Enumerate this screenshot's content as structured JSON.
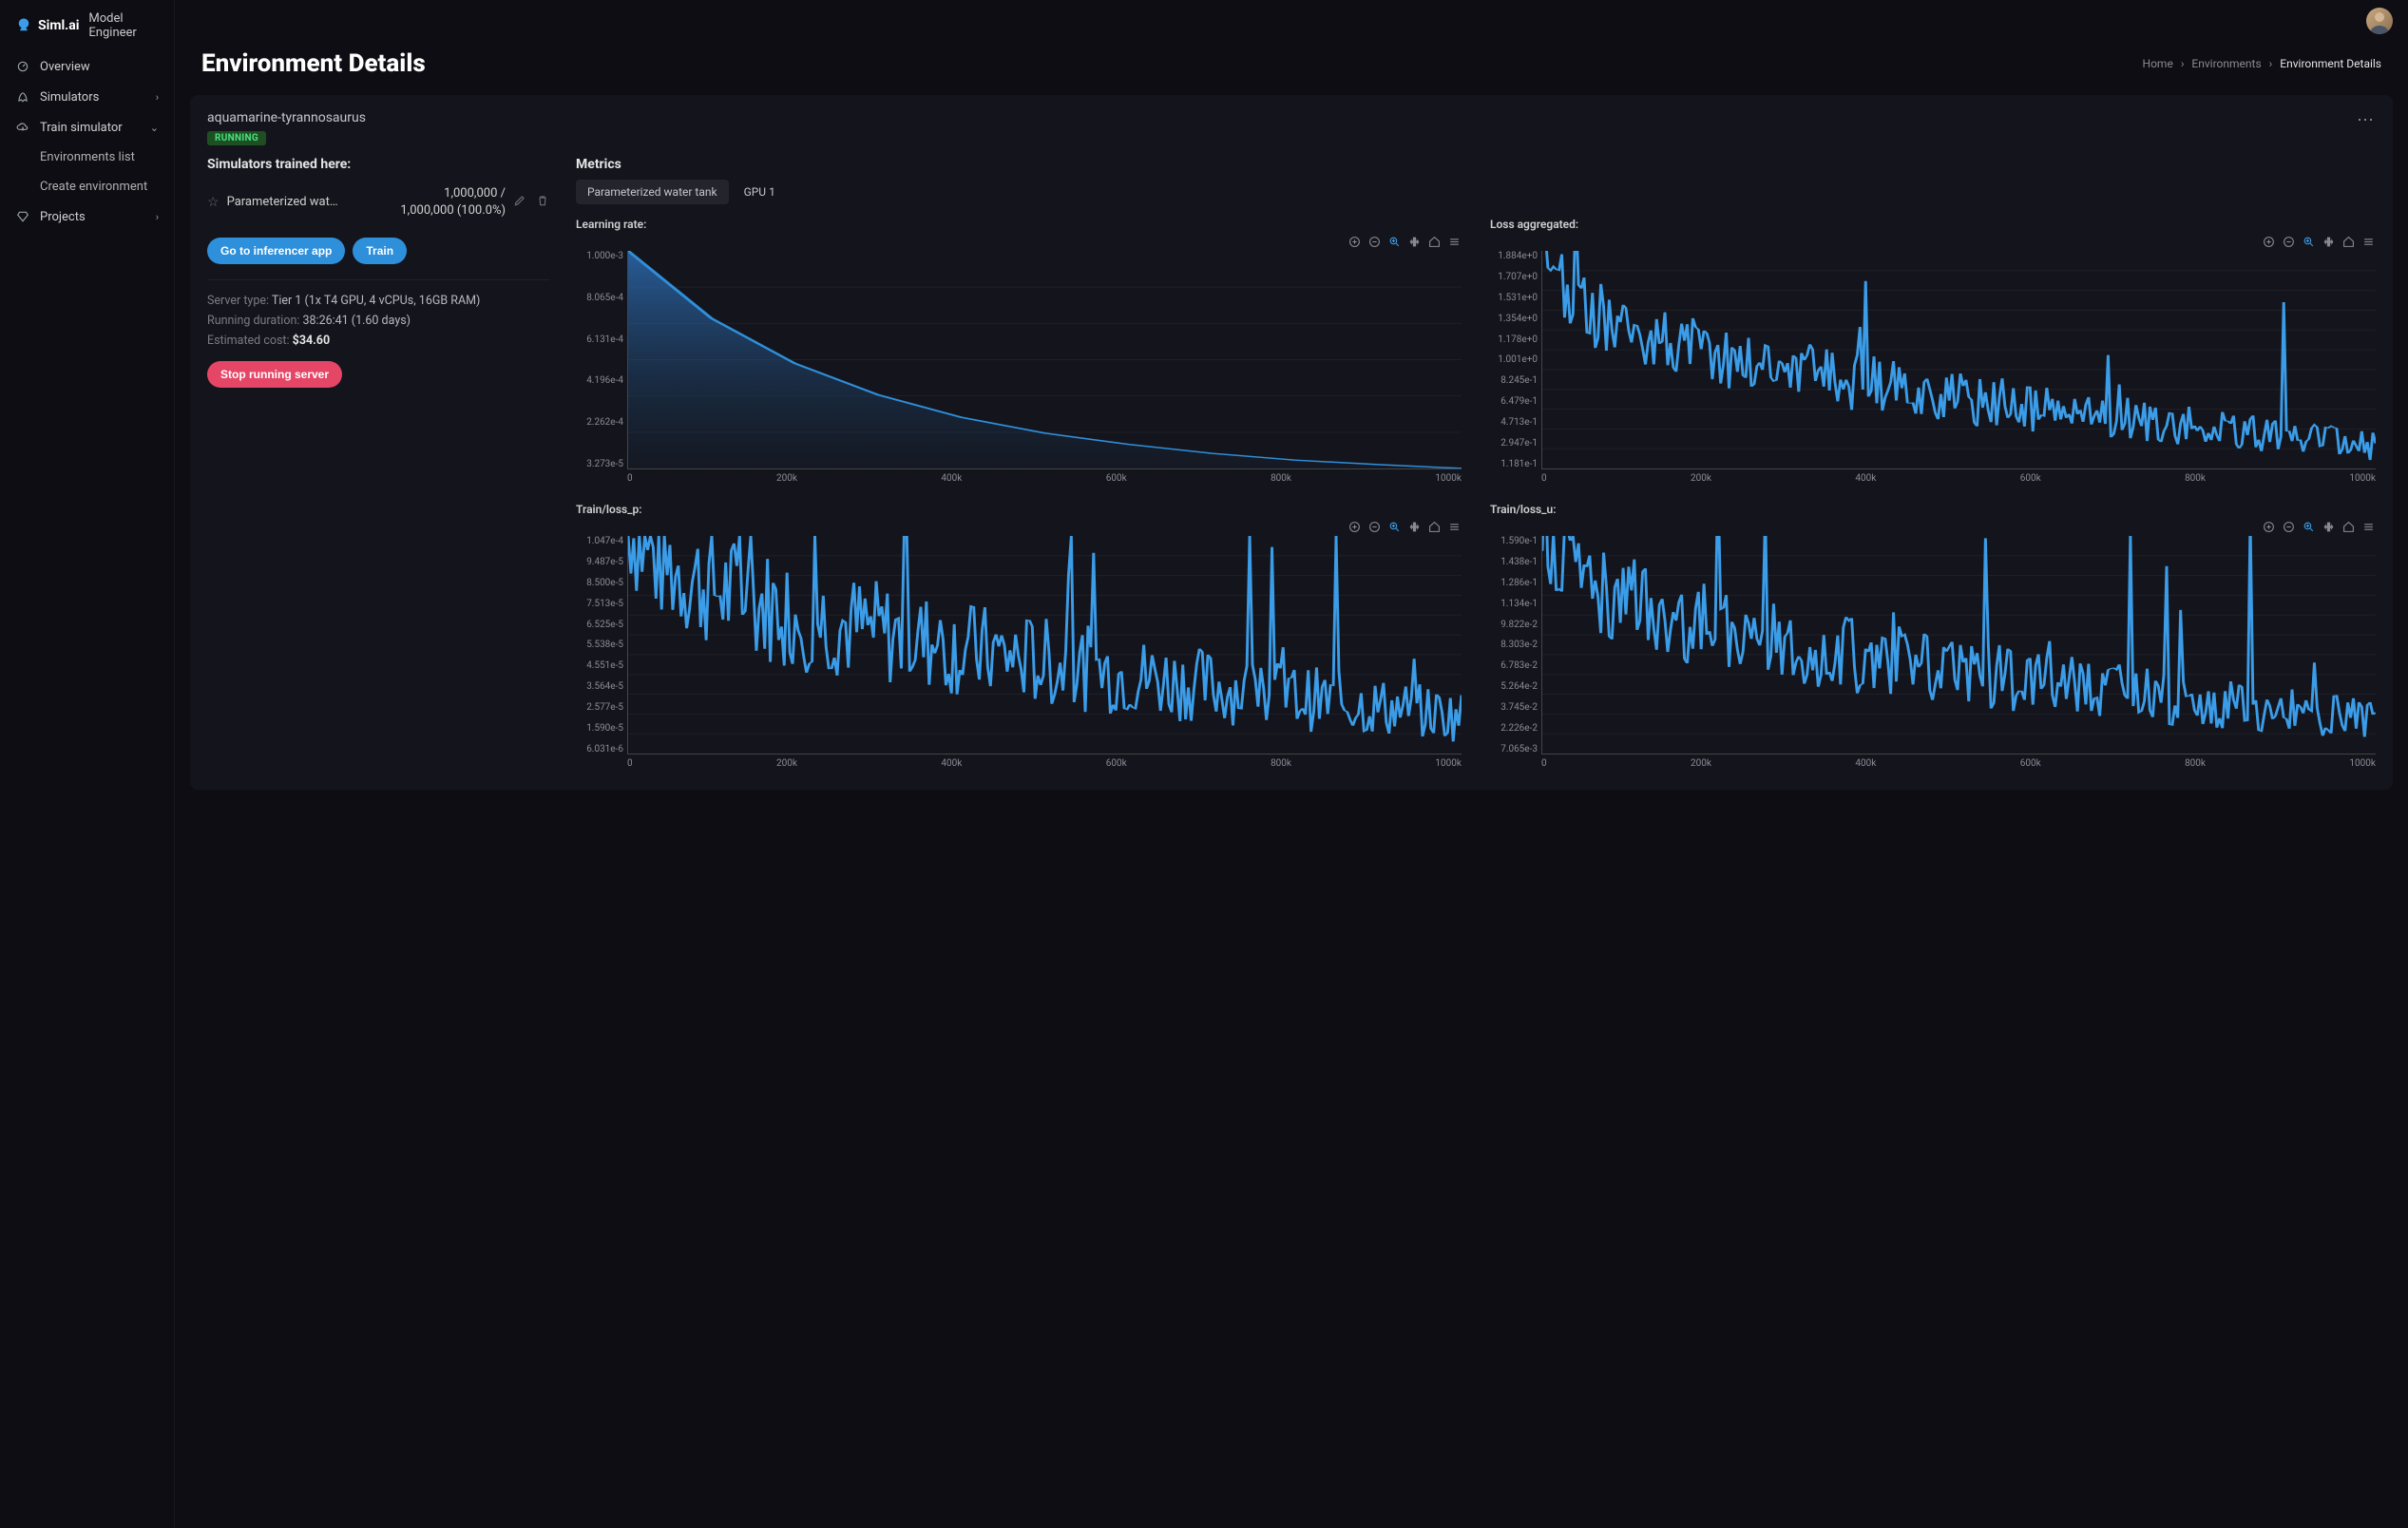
{
  "brand": {
    "name": "Siml.ai",
    "product": "Model Engineer"
  },
  "sidebar": {
    "items": [
      {
        "label": "Overview",
        "icon": "dashboard"
      },
      {
        "label": "Simulators",
        "icon": "rocket",
        "expand": "chevron-right"
      },
      {
        "label": "Train simulator",
        "icon": "cloud-down",
        "expand": "chevron-down"
      },
      {
        "label": "Projects",
        "icon": "diamond",
        "expand": "chevron-right"
      }
    ],
    "train_sub": [
      {
        "label": "Environments list"
      },
      {
        "label": "Create environment"
      }
    ]
  },
  "page": {
    "title": "Environment Details"
  },
  "breadcrumbs": [
    {
      "label": "Home"
    },
    {
      "label": "Environments"
    },
    {
      "label": "Environment Details"
    }
  ],
  "env": {
    "name": "aquamarine-tyrannosaurus",
    "status": "RUNNING",
    "simulators_label": "Simulators trained here:",
    "sim_row": {
      "name": "Parameterized wat…",
      "line1": "1,000,000 /",
      "line2": "1,000,000 (100.0%)"
    },
    "btn_inferencer": "Go to inferencer app",
    "btn_train": "Train",
    "server_type_label": "Server type:",
    "server_type": "Tier 1 (1x T4 GPU, 4 vCPUs, 16GB RAM)",
    "duration_label": "Running duration:",
    "duration": "38:26:41 (1.60 days)",
    "cost_label": "Estimated cost:",
    "cost": "$34.60",
    "btn_stop": "Stop running server"
  },
  "metrics": {
    "label": "Metrics",
    "tabs": [
      {
        "label": "Parameterized water tank",
        "active": true
      },
      {
        "label": "GPU 1",
        "active": false
      }
    ]
  },
  "chart_data": [
    {
      "id": "lr",
      "type": "area",
      "title": "Learning rate:",
      "x_ticks": [
        "0",
        "200k",
        "400k",
        "600k",
        "800k",
        "1000k"
      ],
      "y_ticks": [
        "1.000e-3",
        "8.065e-4",
        "6.131e-4",
        "4.196e-4",
        "2.262e-4",
        "3.273e-5"
      ],
      "xlim": [
        0,
        1000000
      ],
      "ylim": [
        3.273e-05,
        0.001
      ],
      "x": [
        0,
        100000,
        200000,
        300000,
        400000,
        500000,
        600000,
        700000,
        800000,
        900000,
        1000000
      ],
      "y": [
        0.001,
        0.0007,
        0.0005,
        0.00036,
        0.00026,
        0.00019,
        0.00014,
        0.0001,
        7e-05,
        5e-05,
        3.3e-05
      ],
      "note": "Exponential LR decay over 1M steps"
    },
    {
      "id": "loss_agg",
      "type": "line",
      "title": "Loss aggregated:",
      "x_ticks": [
        "0",
        "200k",
        "400k",
        "600k",
        "800k",
        "1000k"
      ],
      "y_ticks": [
        "1.884e+0",
        "1.707e+0",
        "1.531e+0",
        "1.354e+0",
        "1.178e+0",
        "1.001e+0",
        "8.245e-1",
        "6.479e-1",
        "4.713e-1",
        "2.947e-1",
        "1.181e-1"
      ],
      "xlim": [
        0,
        1000000
      ],
      "ylim": [
        0.1181,
        1.884
      ],
      "note": "Noisy decreasing loss; starts ~1.8, settles ~0.15–0.25 with spikes"
    },
    {
      "id": "loss_p",
      "type": "line",
      "title": "Train/loss_p:",
      "x_ticks": [
        "0",
        "200k",
        "400k",
        "600k",
        "800k",
        "1000k"
      ],
      "y_ticks": [
        "1.047e-4",
        "9.487e-5",
        "8.500e-5",
        "7.513e-5",
        "6.525e-5",
        "5.538e-5",
        "4.551e-5",
        "3.564e-5",
        "2.577e-5",
        "1.590e-5",
        "6.031e-6"
      ],
      "xlim": [
        0,
        1000000
      ],
      "ylim": [
        6.031e-06,
        0.0001047
      ],
      "note": "Very spiky loss series; clipped at top early, trending toward ~1.5e-5"
    },
    {
      "id": "loss_u",
      "type": "line",
      "title": "Train/loss_u:",
      "x_ticks": [
        "0",
        "200k",
        "400k",
        "600k",
        "800k",
        "1000k"
      ],
      "y_ticks": [
        "1.590e-1",
        "1.438e-1",
        "1.286e-1",
        "1.134e-1",
        "9.822e-2",
        "8.303e-2",
        "6.783e-2",
        "5.264e-2",
        "3.745e-2",
        "2.226e-2",
        "7.065e-3"
      ],
      "xlim": [
        0,
        1000000
      ],
      "ylim": [
        0.007065,
        0.159
      ],
      "note": "Noisy decreasing series; baseline settles near ~2e-2 with spikes"
    }
  ]
}
